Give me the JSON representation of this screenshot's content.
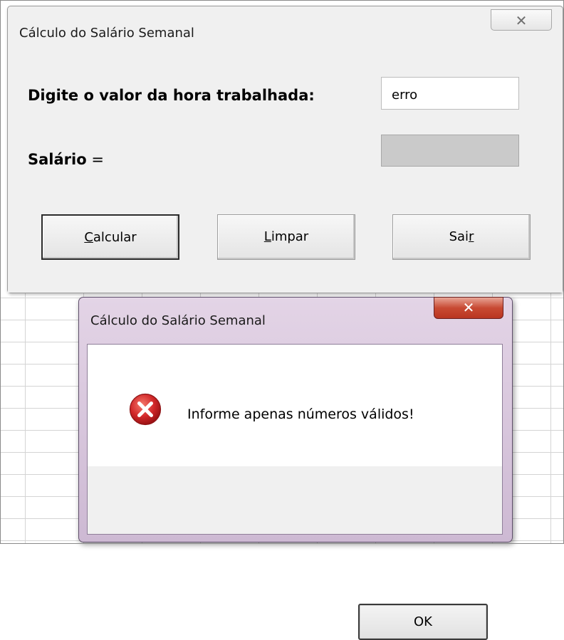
{
  "form": {
    "title": "Cálculo do Salário Semanal",
    "close_glyph": "✕",
    "hourly_label": "Digite o valor da hora trabalhada:",
    "hourly_value": "erro",
    "salary_label_bold": "Salário",
    "salary_label_eq": " =",
    "salary_value": "",
    "buttons": {
      "calcular": {
        "accel": "C",
        "rest": "alcular"
      },
      "limpar": {
        "accel": "L",
        "rest": "impar"
      },
      "sair": {
        "pre": "Sai",
        "accel": "r"
      }
    }
  },
  "msgbox": {
    "title": "Cálculo do Salário Semanal",
    "close_glyph": "✕",
    "icon": "error-icon",
    "message": "Informe apenas números válidos!",
    "ok_label": "OK"
  },
  "colors": {
    "form_bg": "#f0f0f0",
    "msgbox_frame": "#d9c7de",
    "close_red": "#c84a33",
    "error_red": "#d2282a"
  }
}
